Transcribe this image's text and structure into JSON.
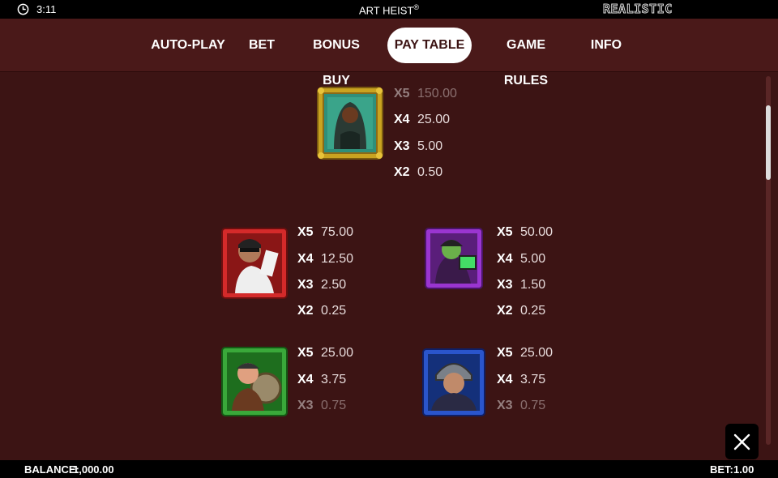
{
  "status_bar": {
    "time": "3:11",
    "title": "ART HEIST",
    "title_mark": "®",
    "brand": "REALISTIC"
  },
  "nav": {
    "tabs": [
      {
        "label": "AUTO-PLAY",
        "active": false
      },
      {
        "label": "BET",
        "active": false
      },
      {
        "label": "BONUS BUY",
        "active": false
      },
      {
        "label": "PAY TABLE",
        "active": true
      },
      {
        "label": "GAME RULES",
        "active": false
      },
      {
        "label": "INFO",
        "active": false
      }
    ]
  },
  "pay_table": {
    "symbols": [
      {
        "name": "painting-symbol",
        "frame_color": "#c9a320",
        "payouts": [
          {
            "mult": "X5",
            "value": "150.00"
          },
          {
            "mult": "X4",
            "value": "25.00"
          },
          {
            "mult": "X3",
            "value": "5.00"
          },
          {
            "mult": "X2",
            "value": "0.50"
          }
        ]
      },
      {
        "name": "red-thief-symbol",
        "frame_color": "#d42a2a",
        "payouts": [
          {
            "mult": "X5",
            "value": "75.00"
          },
          {
            "mult": "X4",
            "value": "12.50"
          },
          {
            "mult": "X3",
            "value": "2.50"
          },
          {
            "mult": "X2",
            "value": "0.25"
          }
        ]
      },
      {
        "name": "purple-hacker-symbol",
        "frame_color": "#9a35d0",
        "payouts": [
          {
            "mult": "X5",
            "value": "50.00"
          },
          {
            "mult": "X4",
            "value": "5.00"
          },
          {
            "mult": "X3",
            "value": "1.50"
          },
          {
            "mult": "X2",
            "value": "0.25"
          }
        ]
      },
      {
        "name": "green-safecracker-symbol",
        "frame_color": "#3aa83a",
        "payouts": [
          {
            "mult": "X5",
            "value": "25.00"
          },
          {
            "mult": "X4",
            "value": "3.75"
          },
          {
            "mult": "X3",
            "value": "0.75"
          }
        ]
      },
      {
        "name": "blue-biker-symbol",
        "frame_color": "#2a55cc",
        "payouts": [
          {
            "mult": "X5",
            "value": "25.00"
          },
          {
            "mult": "X4",
            "value": "3.75"
          },
          {
            "mult": "X3",
            "value": "0.75"
          }
        ]
      }
    ]
  },
  "footer": {
    "balance_label": "BALANCE:",
    "balance_value": "1,000.00",
    "bet_label": "BET:",
    "bet_value": "1.00"
  },
  "icons": {
    "clock": "clock-icon",
    "close": "close-icon"
  }
}
